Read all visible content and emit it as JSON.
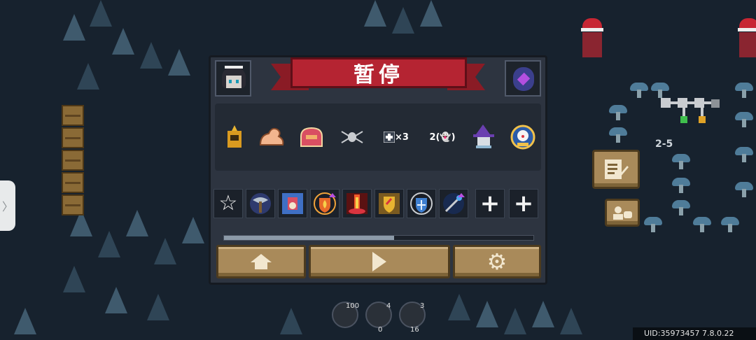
{
  "pause_menu": {
    "title": "暂停",
    "buffs": [
      {
        "name": "golden-helmet-buff-icon"
      },
      {
        "name": "muscle-arm-buff-icon"
      },
      {
        "name": "shield-helmet-buff-icon"
      },
      {
        "name": "spider-buff-icon"
      },
      {
        "name": "multiplier-buff",
        "text": "×3"
      },
      {
        "name": "ghost-buff",
        "text": "2(👻)"
      },
      {
        "name": "wizard-buff-icon"
      },
      {
        "name": "clown-badge-buff-icon"
      }
    ],
    "skill_slots": [
      {
        "name": "star-slot",
        "glyph": "☆"
      },
      {
        "name": "axe-skill-icon"
      },
      {
        "name": "weapon-skill-icon"
      },
      {
        "name": "fire-shield-skill-icon"
      },
      {
        "name": "fire-pillar-skill-icon"
      },
      {
        "name": "gold-shield-skill-icon"
      },
      {
        "name": "ice-shield-skill-icon"
      },
      {
        "name": "staff-skill-icon"
      },
      {
        "name": "empty-slot",
        "glyph": "+"
      },
      {
        "name": "empty-slot",
        "glyph": "+"
      }
    ],
    "progress_fraction": 0.55,
    "buttons": {
      "home": "home",
      "resume": "resume",
      "settings": "settings"
    }
  },
  "side_tab": {
    "glyph": "〉"
  },
  "hud": {
    "level": "2-5",
    "uid": "UID:35973457  7.8.0.22",
    "resources": [
      {
        "top": "100",
        "bottom": ""
      },
      {
        "top": "4",
        "bottom": "0"
      },
      {
        "top": "3",
        "bottom": "16"
      }
    ]
  },
  "colors": {
    "banner": "#b52432",
    "button": "#a98a5a",
    "panel": "#2d3440"
  }
}
